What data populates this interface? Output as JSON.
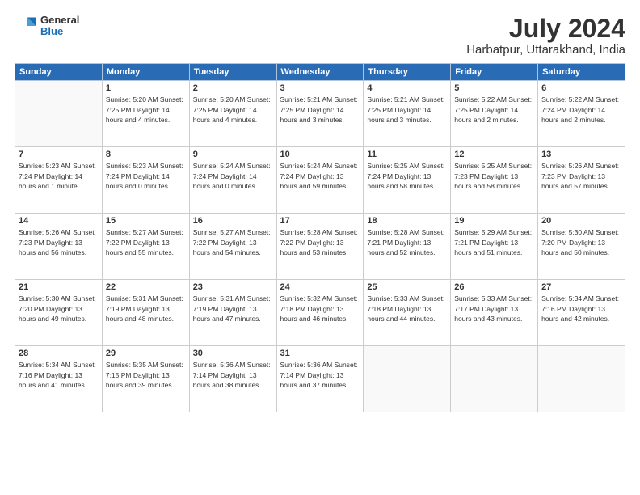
{
  "header": {
    "logo": {
      "general": "General",
      "blue": "Blue"
    },
    "title": "July 2024",
    "subtitle": "Harbatpur, Uttarakhand, India"
  },
  "days_of_week": [
    "Sunday",
    "Monday",
    "Tuesday",
    "Wednesday",
    "Thursday",
    "Friday",
    "Saturday"
  ],
  "weeks": [
    [
      {
        "day": "",
        "info": ""
      },
      {
        "day": "1",
        "info": "Sunrise: 5:20 AM\nSunset: 7:25 PM\nDaylight: 14 hours\nand 4 minutes."
      },
      {
        "day": "2",
        "info": "Sunrise: 5:20 AM\nSunset: 7:25 PM\nDaylight: 14 hours\nand 4 minutes."
      },
      {
        "day": "3",
        "info": "Sunrise: 5:21 AM\nSunset: 7:25 PM\nDaylight: 14 hours\nand 3 minutes."
      },
      {
        "day": "4",
        "info": "Sunrise: 5:21 AM\nSunset: 7:25 PM\nDaylight: 14 hours\nand 3 minutes."
      },
      {
        "day": "5",
        "info": "Sunrise: 5:22 AM\nSunset: 7:25 PM\nDaylight: 14 hours\nand 2 minutes."
      },
      {
        "day": "6",
        "info": "Sunrise: 5:22 AM\nSunset: 7:24 PM\nDaylight: 14 hours\nand 2 minutes."
      }
    ],
    [
      {
        "day": "7",
        "info": "Sunrise: 5:23 AM\nSunset: 7:24 PM\nDaylight: 14 hours\nand 1 minute."
      },
      {
        "day": "8",
        "info": "Sunrise: 5:23 AM\nSunset: 7:24 PM\nDaylight: 14 hours\nand 0 minutes."
      },
      {
        "day": "9",
        "info": "Sunrise: 5:24 AM\nSunset: 7:24 PM\nDaylight: 14 hours\nand 0 minutes."
      },
      {
        "day": "10",
        "info": "Sunrise: 5:24 AM\nSunset: 7:24 PM\nDaylight: 13 hours\nand 59 minutes."
      },
      {
        "day": "11",
        "info": "Sunrise: 5:25 AM\nSunset: 7:24 PM\nDaylight: 13 hours\nand 58 minutes."
      },
      {
        "day": "12",
        "info": "Sunrise: 5:25 AM\nSunset: 7:23 PM\nDaylight: 13 hours\nand 58 minutes."
      },
      {
        "day": "13",
        "info": "Sunrise: 5:26 AM\nSunset: 7:23 PM\nDaylight: 13 hours\nand 57 minutes."
      }
    ],
    [
      {
        "day": "14",
        "info": "Sunrise: 5:26 AM\nSunset: 7:23 PM\nDaylight: 13 hours\nand 56 minutes."
      },
      {
        "day": "15",
        "info": "Sunrise: 5:27 AM\nSunset: 7:22 PM\nDaylight: 13 hours\nand 55 minutes."
      },
      {
        "day": "16",
        "info": "Sunrise: 5:27 AM\nSunset: 7:22 PM\nDaylight: 13 hours\nand 54 minutes."
      },
      {
        "day": "17",
        "info": "Sunrise: 5:28 AM\nSunset: 7:22 PM\nDaylight: 13 hours\nand 53 minutes."
      },
      {
        "day": "18",
        "info": "Sunrise: 5:28 AM\nSunset: 7:21 PM\nDaylight: 13 hours\nand 52 minutes."
      },
      {
        "day": "19",
        "info": "Sunrise: 5:29 AM\nSunset: 7:21 PM\nDaylight: 13 hours\nand 51 minutes."
      },
      {
        "day": "20",
        "info": "Sunrise: 5:30 AM\nSunset: 7:20 PM\nDaylight: 13 hours\nand 50 minutes."
      }
    ],
    [
      {
        "day": "21",
        "info": "Sunrise: 5:30 AM\nSunset: 7:20 PM\nDaylight: 13 hours\nand 49 minutes."
      },
      {
        "day": "22",
        "info": "Sunrise: 5:31 AM\nSunset: 7:19 PM\nDaylight: 13 hours\nand 48 minutes."
      },
      {
        "day": "23",
        "info": "Sunrise: 5:31 AM\nSunset: 7:19 PM\nDaylight: 13 hours\nand 47 minutes."
      },
      {
        "day": "24",
        "info": "Sunrise: 5:32 AM\nSunset: 7:18 PM\nDaylight: 13 hours\nand 46 minutes."
      },
      {
        "day": "25",
        "info": "Sunrise: 5:33 AM\nSunset: 7:18 PM\nDaylight: 13 hours\nand 44 minutes."
      },
      {
        "day": "26",
        "info": "Sunrise: 5:33 AM\nSunset: 7:17 PM\nDaylight: 13 hours\nand 43 minutes."
      },
      {
        "day": "27",
        "info": "Sunrise: 5:34 AM\nSunset: 7:16 PM\nDaylight: 13 hours\nand 42 minutes."
      }
    ],
    [
      {
        "day": "28",
        "info": "Sunrise: 5:34 AM\nSunset: 7:16 PM\nDaylight: 13 hours\nand 41 minutes."
      },
      {
        "day": "29",
        "info": "Sunrise: 5:35 AM\nSunset: 7:15 PM\nDaylight: 13 hours\nand 39 minutes."
      },
      {
        "day": "30",
        "info": "Sunrise: 5:36 AM\nSunset: 7:14 PM\nDaylight: 13 hours\nand 38 minutes."
      },
      {
        "day": "31",
        "info": "Sunrise: 5:36 AM\nSunset: 7:14 PM\nDaylight: 13 hours\nand 37 minutes."
      },
      {
        "day": "",
        "info": ""
      },
      {
        "day": "",
        "info": ""
      },
      {
        "day": "",
        "info": ""
      }
    ]
  ]
}
